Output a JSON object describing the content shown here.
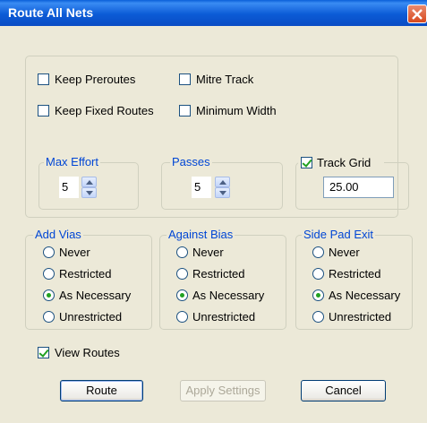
{
  "window": {
    "title": "Route All Nets"
  },
  "options": {
    "keep_preroutes": {
      "label": "Keep Preroutes",
      "checked": false
    },
    "mitre_track": {
      "label": "Mitre Track",
      "checked": false
    },
    "keep_fixed_routes": {
      "label": "Keep Fixed Routes",
      "checked": false
    },
    "minimum_width": {
      "label": "Minimum Width",
      "checked": false
    }
  },
  "max_effort": {
    "label": "Max Effort",
    "value": "5"
  },
  "passes": {
    "label": "Passes",
    "value": "5"
  },
  "track_grid": {
    "label": "Track Grid",
    "checked": true,
    "value": "25.00"
  },
  "add_vias": {
    "label": "Add Vias",
    "options": [
      "Never",
      "Restricted",
      "As Necessary",
      "Unrestricted"
    ],
    "selected": "As Necessary"
  },
  "against_bias": {
    "label": "Against Bias",
    "options": [
      "Never",
      "Restricted",
      "As Necessary",
      "Unrestricted"
    ],
    "selected": "As Necessary"
  },
  "side_pad_exit": {
    "label": "Side Pad Exit",
    "options": [
      "Never",
      "Restricted",
      "As Necessary",
      "Unrestricted"
    ],
    "selected": "As Necessary"
  },
  "view_routes": {
    "label": "View Routes",
    "checked": true
  },
  "buttons": {
    "route": "Route",
    "apply": "Apply Settings",
    "cancel": "Cancel"
  },
  "colors": {
    "titlebar": "#0a5fd8",
    "legend": "#0046d5",
    "face": "#ece9d8"
  }
}
